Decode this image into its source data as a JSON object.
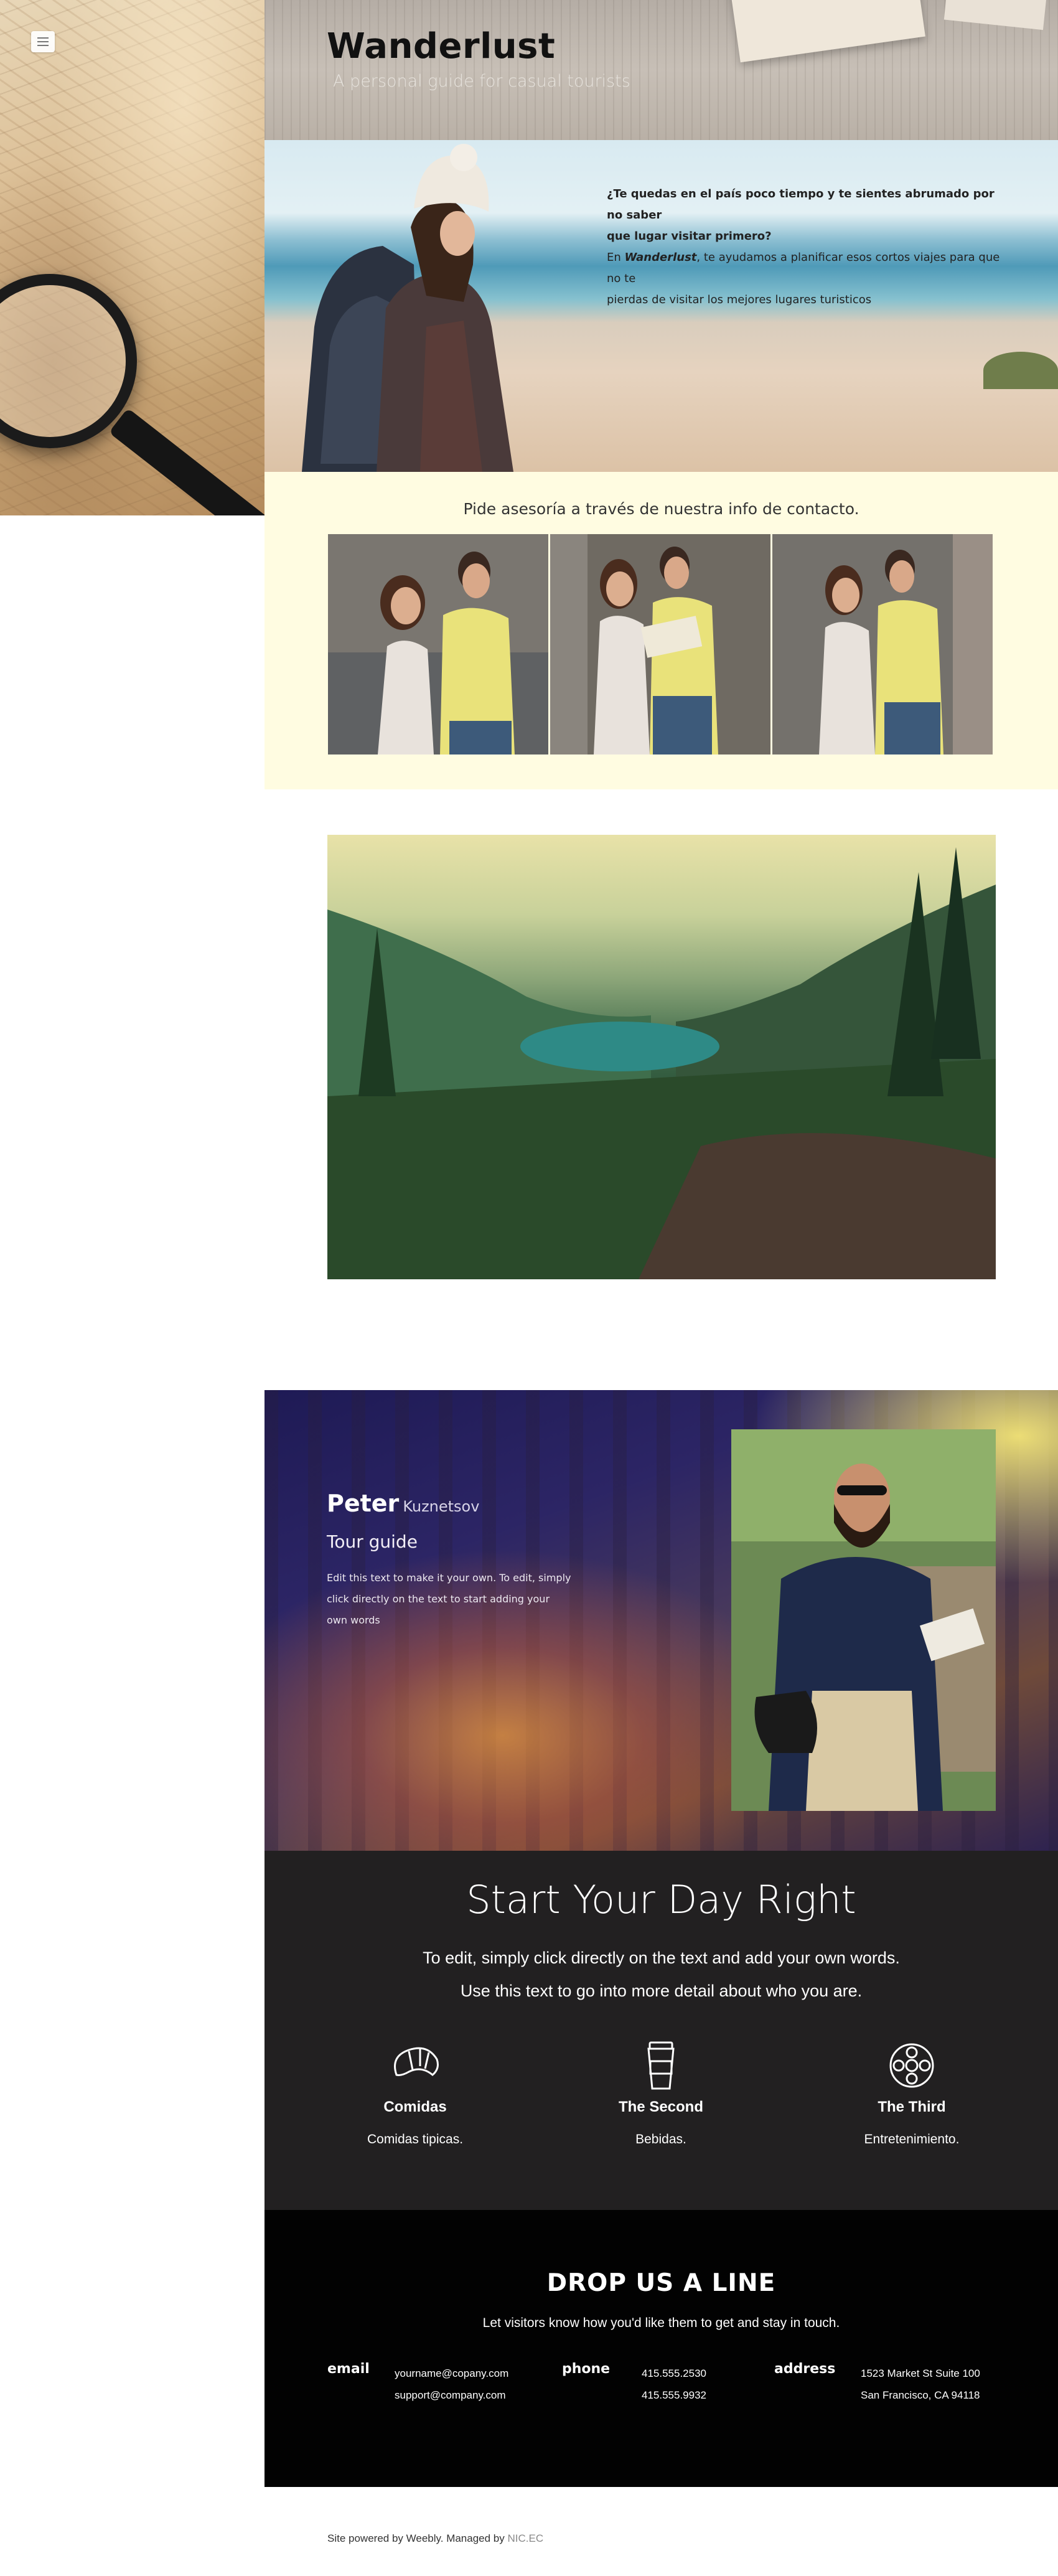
{
  "site": {
    "title": "Wanderlust",
    "subtitle": "A personal guide for casual tourists"
  },
  "nav": {
    "menu_icon": "hamburger-icon"
  },
  "hero": {
    "question_line_1": "¿Te quedas en el país poco tiempo y te sientes abrumado por no saber",
    "question_line_2": "que lugar visitar primero?",
    "answer_prefix": "En ",
    "answer_brand": "Wanderlust",
    "answer_rest_1": ", te ayudamos a planificar esos cortos viajes para que no te",
    "answer_line_2": "pierdas de visitar los mejores lugares turisticos"
  },
  "contact_band": {
    "title": "Pide asesoría a través de nuestra info de contacto."
  },
  "guide": {
    "first_name": "Peter",
    "last_name": "Kuznetsov",
    "role": "Tour guide",
    "desc_line_1": "Edit this text to make it your own. To edit, simply",
    "desc_line_2": "click directly on the text to start adding your",
    "desc_line_3": "own words"
  },
  "day_section": {
    "title": "Start Your Day Right",
    "line_1": "To edit, simply click directly on the text and add your own words.",
    "line_2": "Use this text to go into more detail about who you are.",
    "features": [
      {
        "icon": "croissant-icon",
        "title": "Comidas",
        "text": "Comidas tipicas."
      },
      {
        "icon": "coffee-cup-icon",
        "title": "The Second",
        "text": "Bebidas."
      },
      {
        "icon": "flower-icon",
        "title": "The Third",
        "text": "Entretenimiento."
      }
    ]
  },
  "contact": {
    "title": "DROP US A LINE",
    "subtitle": "Let visitors know how you'd like them to get and stay in touch.",
    "email_label": "email",
    "email_1": "yourname@copany.com",
    "email_2": "support@company.com",
    "phone_label": "phone",
    "phone_1": "415.555.2530",
    "phone_2": "415.555.9932",
    "address_label": "address",
    "address_1": "1523 Market St  Suite 100",
    "address_2": "San Francisco, CA 94118"
  },
  "footer": {
    "text": "Site powered by Weebly. Managed by ",
    "link": "NIC.EC"
  }
}
